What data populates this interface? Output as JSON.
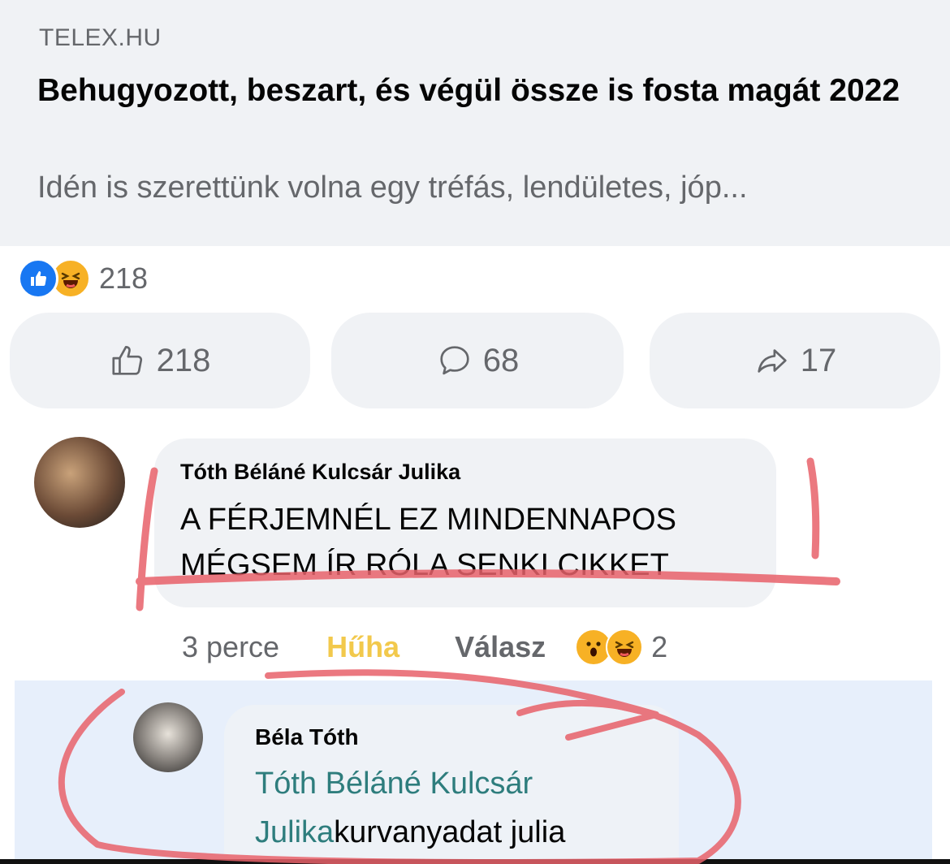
{
  "link_preview": {
    "source": "TELEX.HU",
    "headline": "Behugyozott, beszart, és végül össze is fosta magát 2022",
    "description": "Idén is szerettünk volna egy tréfás, lendületes, jóp..."
  },
  "reactions": {
    "icons": [
      "like-icon",
      "haha-icon"
    ],
    "count": "218"
  },
  "actions": {
    "like_count": "218",
    "comment_count": "68",
    "share_count": "17"
  },
  "comment": {
    "author": "Tóth Béláné Kulcsár Julika",
    "text": "A FÉRJEMNÉL EZ MINDENNAPOS MÉGSEM ÍR RÓLA SENKI CIKKET",
    "time": "3 perce",
    "reaction_label": "Hűha",
    "reply_label": "Válasz",
    "reaction_icons": [
      "wow-icon",
      "haha-icon"
    ],
    "reaction_count": "2"
  },
  "reply": {
    "author": "Béla Tóth",
    "mention": "Tóth Béláné Kulcsár Julika",
    "text": "kurvanyadat julia"
  },
  "colors": {
    "preview_bg": "#f0f2f5",
    "reply_highlight_bg": "#e7effb",
    "annotation_red": "#e8616a",
    "reaction_huha": "#f2c94c",
    "mention": "#2e7d7d"
  }
}
